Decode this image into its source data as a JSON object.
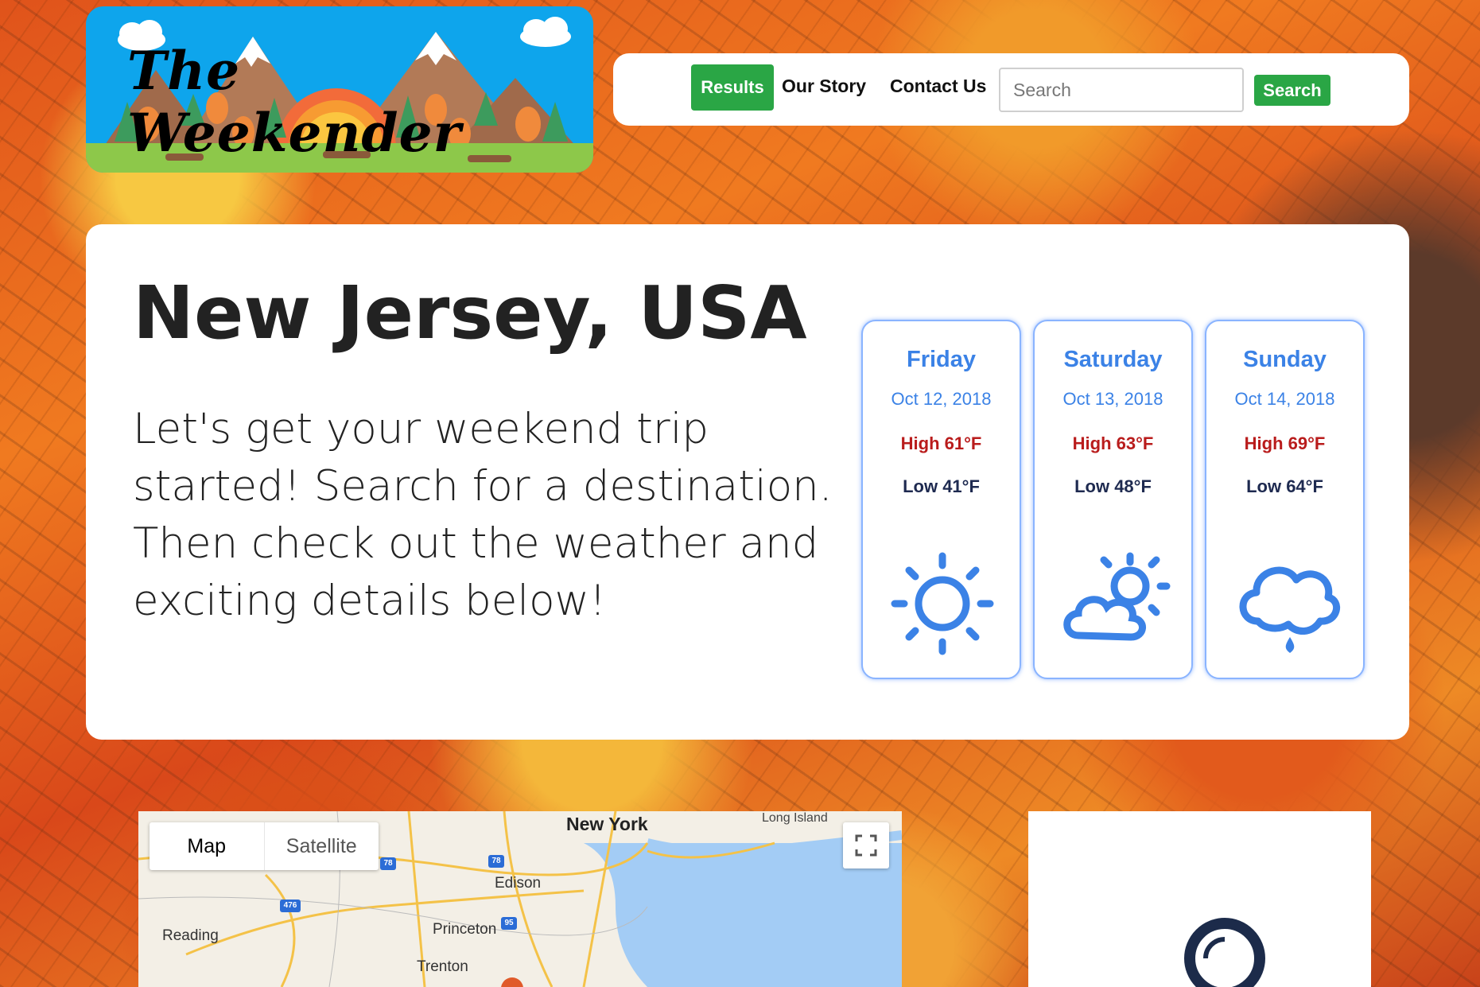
{
  "logo": {
    "title": "The Weekender"
  },
  "nav": {
    "results_label": "Results",
    "story_label": "Our Story",
    "contact_label": "Contact Us",
    "search_placeholder": "Search",
    "search_button": "Search"
  },
  "hero": {
    "title": "New Jersey, USA",
    "text": "Let's get your weekend trip started! Search for a destination. Then check out the weather and exciting details below!"
  },
  "forecast": [
    {
      "day": "Friday",
      "date": "Oct 12, 2018",
      "high": "High 61°F",
      "low": "Low 41°F",
      "icon": "sun-icon"
    },
    {
      "day": "Saturday",
      "date": "Oct 13, 2018",
      "high": "High 63°F",
      "low": "Low 48°F",
      "icon": "partly-cloudy-icon"
    },
    {
      "day": "Sunday",
      "date": "Oct 14, 2018",
      "high": "High 69°F",
      "low": "Low 64°F",
      "icon": "rain-cloud-icon"
    }
  ],
  "map": {
    "tabs": [
      "Map",
      "Satellite"
    ],
    "places": {
      "new_york": "New York",
      "long_island": "Long Island",
      "edison": "Edison",
      "reading": "Reading",
      "princeton": "Princeton",
      "trenton": "Trenton"
    },
    "highways": {
      "h78a": "78",
      "h78b": "78",
      "h476": "476",
      "h95": "95"
    }
  },
  "colors": {
    "green": "#2aa645",
    "blue": "#3b82e6",
    "high": "#b91c1c",
    "low": "#1e2a50",
    "search_icon": "#1c2b4a"
  }
}
